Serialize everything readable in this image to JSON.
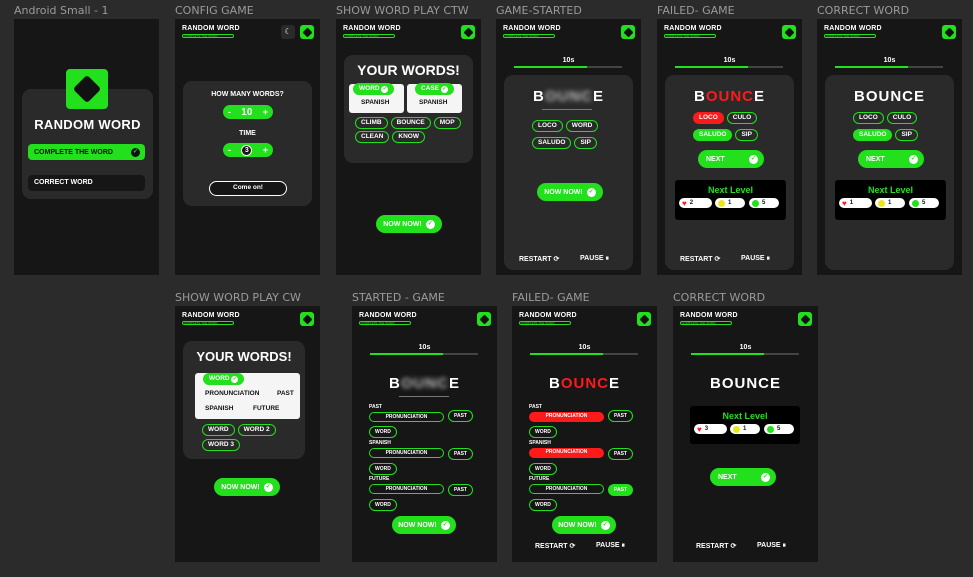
{
  "frames": {
    "f1": {
      "label": "Android Small - 1",
      "title": "RANDOM WORD",
      "btn1": "COMPLETE THE WORD",
      "btn2": "CORRECT WORD"
    },
    "f2": {
      "label": "CONFIG GAME",
      "logo": "RANDOM WORD",
      "logo_sub": "COMPLETE THE WORD",
      "q": "HOW MANY WORDS?",
      "minus": "-",
      "plus": "+",
      "count": "10",
      "time": "TIME",
      "tval": "3",
      "go": "Come on!"
    },
    "f3": {
      "label": "SHOW WORD PLAY CTW",
      "logo": "RANDOM WORD",
      "logo_sub": "COMPLETE THE WORD",
      "title": "YOUR WORDS!",
      "sel1": "WORD",
      "sel2": "CASE",
      "sub1": "SPANISH",
      "sub2": "SPANISH",
      "w1": "CLIMB",
      "w2": "BOUNCE",
      "w3": "MOP",
      "w4": "CLEAN",
      "w5": "KNOW",
      "now": "NOW NOW!"
    },
    "f4": {
      "label": "GAME-STARTED",
      "logo": "RANDOM WORD",
      "logo_sub": "COMPLETE THE WORD",
      "time": "10s",
      "w_b": "B",
      "w_mid": "OUNC",
      "w_e": "E",
      "o1": "LOCO",
      "o2": "WORD",
      "o3": "SALUDO",
      "o4": "SIP",
      "now": "NOW NOW!",
      "restart": "RESTART ⟳",
      "pause": "PAUSE ⏸"
    },
    "f5": {
      "label": "FAILED- GAME",
      "logo": "RANDOM WORD",
      "logo_sub": "COMPLETE THE WORD",
      "w_b": "B",
      "w_mid": "OUNC",
      "w_e": "E",
      "o1": "LOCO",
      "o2": "CULO",
      "o3": "SALUDO",
      "o4": "SIP",
      "next": "NEXT",
      "lvl": "Next Level",
      "s1": "2",
      "s2": "1",
      "s3": "5",
      "restart": "RESTART ⟳",
      "pause": "PAUSE ⏸"
    },
    "f6": {
      "label": "CORRECT WORD",
      "logo": "RANDOM WORD",
      "logo_sub": "COMPLETE THE WORD",
      "time": "10s",
      "word": "BOUNCE",
      "o1": "LOCO",
      "o2": "CULO",
      "o3": "SALUDO",
      "o4": "SIP",
      "next": "NEXT",
      "lvl": "Next Level",
      "s1": "1",
      "s2": "1",
      "s3": "5"
    },
    "f7": {
      "label": "SHOW WORD PLAY CW",
      "logo": "RANDOM WORD",
      "logo_sub": "COMPLETE THE WORD",
      "title": "YOUR WORDS!",
      "sel": "WORD",
      "r1a": "PRONUNCIATION",
      "r1b": "PAST",
      "r2a": "SPANISH",
      "r2b": "FUTURE",
      "w1": "WORD",
      "w2": "WORD 2",
      "w3": "WORD 3",
      "now": "NOW NOW!"
    },
    "f8": {
      "label": "STARTED - GAME",
      "logo": "RANDOM WORD",
      "logo_sub": "COMPLETE THE WORD",
      "time": "10s",
      "w_b": "B",
      "w_mid": "OUNC",
      "w_e": "E",
      "l1": "PAST",
      "l2": "SPANISH",
      "l3": "FUTURE",
      "pron": "PRONUNCIATION",
      "past": "PAST",
      "word": "WORD",
      "now": "NOW NOW!"
    },
    "f9": {
      "label": "FAILED- GAME",
      "logo": "RANDOM WORD",
      "logo_sub": "COMPLETE THE WORD",
      "time": "10s",
      "w_b": "B",
      "w_mid": "OUNC",
      "w_e": "E",
      "l1": "PAST",
      "l2": "SPANISH",
      "l3": "FUTURE",
      "pron": "PRONUNCIATION",
      "past": "PAST",
      "word": "WORD",
      "now": "NOW NOW!",
      "restart": "RESTART ⟳",
      "pause": "PAUSE ⏸"
    },
    "f10": {
      "label": "CORRECT WORD",
      "logo": "RANDOM WORD",
      "logo_sub": "COMPLETE THE WORD",
      "time": "10s",
      "word": "BOUNCE",
      "lvl": "Next Level",
      "s1": "3",
      "s2": "1",
      "s3": "5",
      "next": "NEXT",
      "restart": "RESTART ⟳",
      "pause": "PAUSE ⏸"
    }
  },
  "colors": {
    "green": "#23e01d",
    "red": "#ff1a1a",
    "bg": "#161616",
    "card": "#2a2a2a"
  }
}
